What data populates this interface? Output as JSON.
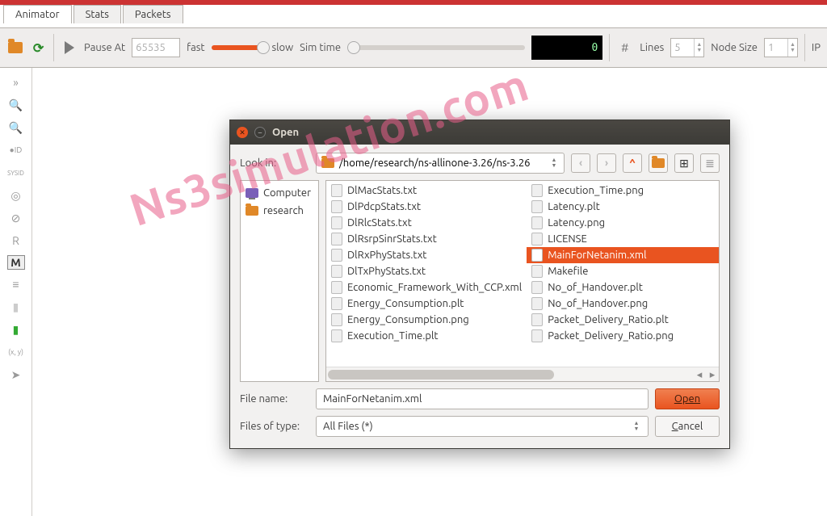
{
  "tabs": {
    "animator": "Animator",
    "stats": "Stats",
    "packets": "Packets"
  },
  "toolbar": {
    "pause_at_label": "Pause At",
    "pause_at_value": "65535",
    "fast_label": "fast",
    "slow_label": "slow",
    "sim_time_label": "Sim time",
    "lcd_value": "0",
    "lines_label": "Lines",
    "lines_value": "5",
    "node_size_label": "Node Size",
    "node_size_value": "1",
    "ip_label": "IP"
  },
  "sidebar_icons": [
    "expand",
    "zoom-in",
    "zoom-out",
    "id-tag",
    "sysid",
    "circle",
    "slash",
    "R",
    "M",
    "list",
    "battery",
    "battery-full",
    "cursor"
  ],
  "sidebar_R": "R",
  "sidebar_M": "M",
  "sidebar_xy": "(x, y)",
  "dialog": {
    "title": "Open",
    "look_in_label": "Look in:",
    "path": "/home/research/ns-allinone-3.26/ns-3.26",
    "places": {
      "computer": "Computer",
      "research": "research"
    },
    "col1": [
      "DlMacStats.txt",
      "DlPdcpStats.txt",
      "DlRlcStats.txt",
      "DlRsrpSinrStats.txt",
      "DlRxPhyStats.txt",
      "DlTxPhyStats.txt",
      "Economic_Framework_With_CCP.xml",
      "Energy_Consumption.plt",
      "Energy_Consumption.png",
      "Execution_Time.plt"
    ],
    "col2": [
      "Execution_Time.png",
      "Latency.plt",
      "Latency.png",
      "LICENSE",
      "MainForNetanim.xml",
      "Makefile",
      "No_of_Handover.plt",
      "No_of_Handover.png",
      "Packet_Delivery_Ratio.plt",
      "Packet_Delivery_Ratio.png"
    ],
    "selected_index_col2": 4,
    "file_name_label": "File name:",
    "file_name_value": "MainForNetanim.xml",
    "files_type_label": "Files of type:",
    "files_type_value": "All Files (*)",
    "open_btn": "Open",
    "cancel_btn": "Cancel"
  },
  "watermark": "Ns3simulation.com"
}
